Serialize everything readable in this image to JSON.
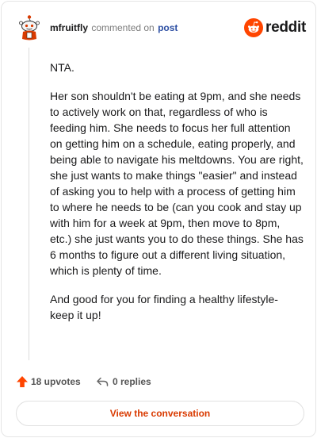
{
  "comment": {
    "username": "mfruitfly",
    "action": "commented on",
    "target": "post",
    "paragraphs": [
      "NTA.",
      "Her son shouldn't be eating at 9pm, and she needs to actively work on that, regardless of who is feeding him. She needs to focus her full attention on getting him on a schedule, eating properly, and being able to navigate his meltdowns. You are right, she just wants to make things \"easier\" and instead of asking you to help with a process of getting him to where he needs to be (can you cook and stay up with him for a week at 9pm, then move to 8pm, etc.) she just wants you to do these things. She has 6 months to figure out a different living situation, which is plenty of time.",
      "And good for you for finding a healthy lifestyle- keep it up!"
    ]
  },
  "brand": {
    "name": "reddit",
    "icon": "reddit-logo-icon",
    "color": "#ff4500"
  },
  "footer": {
    "upvotes": "18 upvotes",
    "replies": "0 replies",
    "upvote_icon": "upvote-arrow-icon",
    "reply_icon": "reply-arrow-icon"
  },
  "actions": {
    "view_conversation": "View the conversation"
  },
  "colors": {
    "accent": "#d93a00",
    "upvote": "#ff4500",
    "link": "#2d4fa3"
  }
}
